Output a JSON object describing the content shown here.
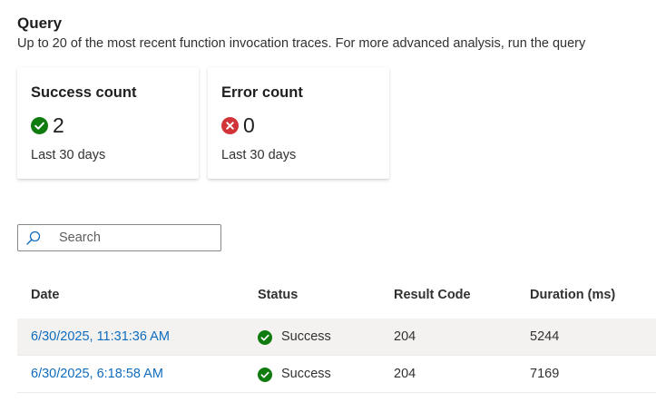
{
  "section": {
    "title": "Query",
    "description": "Up to 20 of the most recent function invocation traces. For more advanced analysis, run the query"
  },
  "cards": {
    "success": {
      "title": "Success count",
      "value": "2",
      "subtitle": "Last 30 days",
      "icon": "check-circle-icon",
      "color": "#107c10"
    },
    "error": {
      "title": "Error count",
      "value": "0",
      "subtitle": "Last 30 days",
      "icon": "error-circle-icon",
      "color": "#d13438"
    }
  },
  "search": {
    "placeholder": "Search",
    "value": "",
    "icon": "search-icon"
  },
  "table": {
    "columns": {
      "date": "Date",
      "status": "Status",
      "result_code": "Result Code",
      "duration": "Duration (ms)"
    },
    "rows": [
      {
        "date": "6/30/2025, 11:31:36 AM",
        "status": "Success",
        "result_code": "204",
        "duration": "5244"
      },
      {
        "date": "6/30/2025, 6:18:58 AM",
        "status": "Success",
        "result_code": "204",
        "duration": "7169"
      }
    ]
  },
  "colors": {
    "link": "#0f6cbd",
    "success": "#107c10",
    "error": "#d13438",
    "row_hover": "#f3f2f1"
  }
}
